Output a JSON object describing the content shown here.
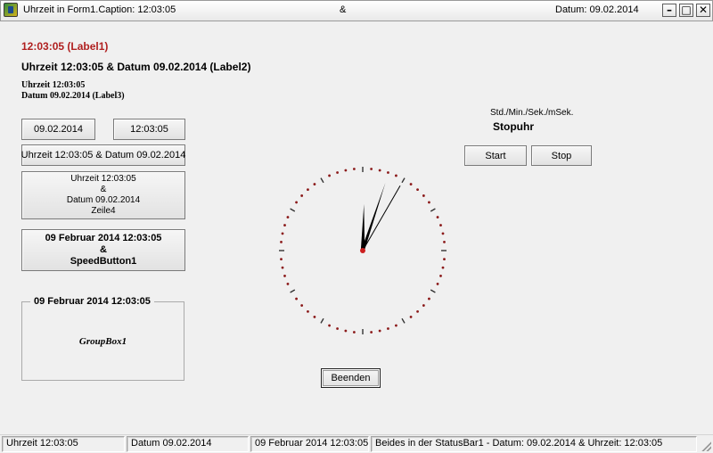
{
  "window": {
    "caption_left": "Uhrzeit in Form1.Caption:  12:03:05",
    "caption_mid": "&",
    "caption_right": "Datum: 09.02.2014",
    "minimize": "–",
    "maximize": "□",
    "close": "✕"
  },
  "labels": {
    "label1": "12:03:05  (Label1)",
    "label2": "Uhrzeit 12:03:05  &  Datum 09.02.2014  (Label2)",
    "label3_line1": "Uhrzeit 12:03:05",
    "label3_line2": "Datum 09.02.2014  (Label3)"
  },
  "buttons": {
    "date": "09.02.2014",
    "time": "12:03:05",
    "both": "Uhrzeit 12:03:05 & Datum 09.02.2014",
    "multi": [
      "Uhrzeit 12:03:05",
      "&",
      "Datum 09.02.2014",
      "Zeile4"
    ],
    "speed": [
      "09  Februar  2014    12:03:05",
      "&",
      "SpeedButton1"
    ],
    "exit": "Beenden"
  },
  "groupbox": {
    "caption": "09  Februar  2014    12:03:05",
    "label": "GroupBox1"
  },
  "stopwatch": {
    "units": "Std./Min./Sek./mSek.",
    "title": "Stopuhr",
    "start": "Start",
    "stop": "Stop"
  },
  "clock": {
    "hours": 12,
    "minutes": 3,
    "seconds": 5,
    "dot_color": "#8b1a1a",
    "tick_color": "#333333",
    "hand_color": "#000000",
    "center_color": "#cc2020"
  },
  "statusbar": {
    "p1": "Uhrzeit   12:03:05",
    "p2": "Datum  09.02.2014",
    "p3": "09  Februar  2014  12:03:05",
    "p4": "Beides in der StatusBar1 - Datum:  09.02.2014  &  Uhrzeit:    12:03:05"
  }
}
